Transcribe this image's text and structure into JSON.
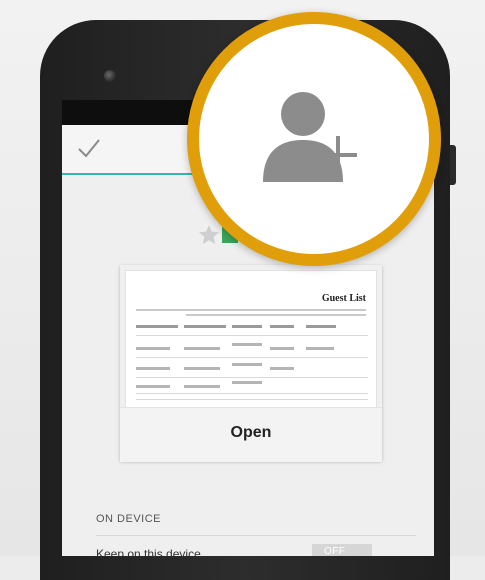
{
  "preview": {
    "doc_title": "Guest List",
    "open_label": "Open"
  },
  "on_device": {
    "section_label": "ON DEVICE",
    "keep_label": "Keep on this device",
    "toggle_label": "OFF"
  },
  "icons": {
    "done": "check-icon",
    "rating": "star-icon",
    "file_type": "spreadsheet-icon",
    "badge": "add-person-icon"
  },
  "colors": {
    "accent": "#35b6b0",
    "badge_ring": "#e09f0a",
    "person": "#8c8c8c",
    "sheet": "#3aa757"
  }
}
